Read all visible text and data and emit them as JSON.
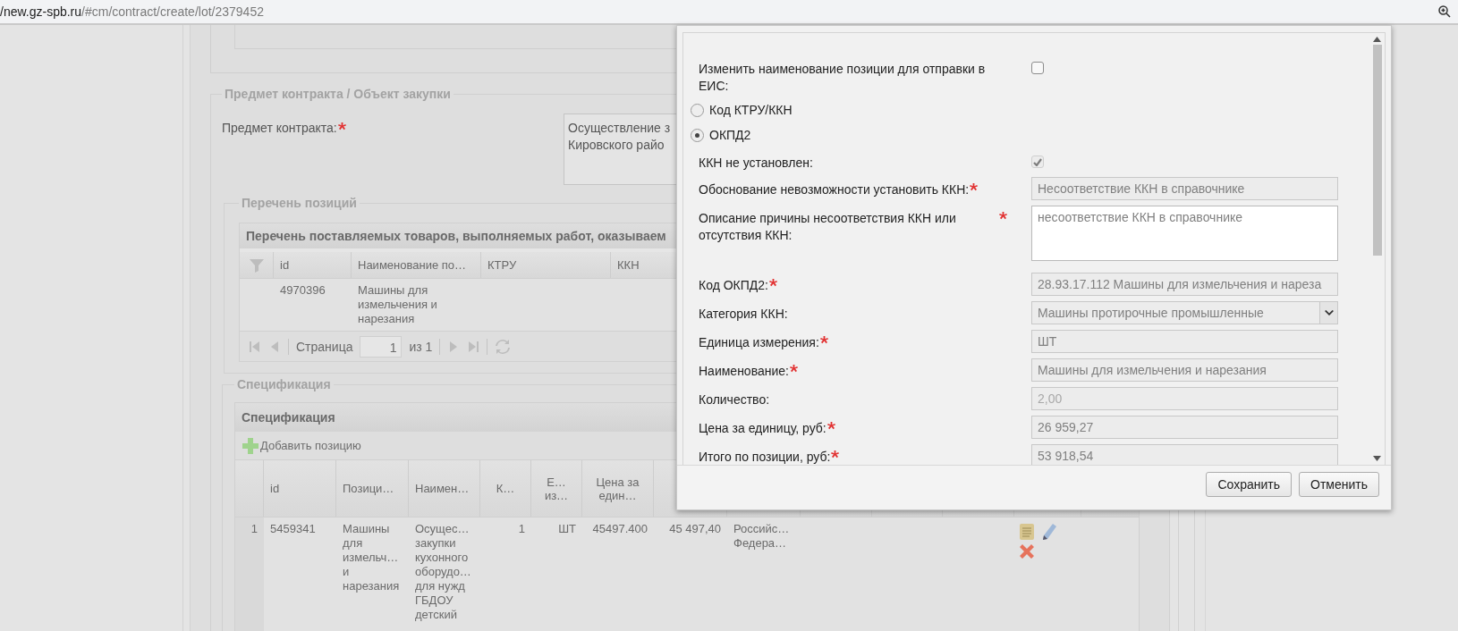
{
  "address_bar": {
    "host": "/new.gz-spb.ru",
    "path": "/#cm/contract/create/lot/2379452"
  },
  "contract_subject": {
    "legend": "Предмет контракта / Объект закупки",
    "label": "Предмет контракта:",
    "required": true,
    "value": "Осуществление з\nКировского райо"
  },
  "positions": {
    "legend": "Перечень позиций",
    "grid_title": "Перечень поставляемых товаров, выполняемых работ, оказываем",
    "columns": [
      "id",
      "Наименование по…",
      "КТРУ",
      "ККН"
    ],
    "rows": [
      {
        "cells": [
          "4970396",
          "Машины для\nизмельчения и\nнарезания"
        ]
      }
    ],
    "pager": {
      "page_label": "Страница",
      "page": "1",
      "total": "из 1"
    }
  },
  "specification": {
    "legend": "Спецификация",
    "grid_title": "Спецификация",
    "add_button": "Добавить позицию",
    "columns": [
      "id",
      "Позици…",
      "Наимен…",
      "К…",
      "Е…\nиз…",
      "Цена за\nедин…"
    ],
    "rows": [
      {
        "number": "1",
        "cells": [
          "5459341",
          "Машины\nдля\nизмельч…\nи\nнарезания",
          "Осущес…\nзакупки\nкухонного\nоборудо…\nдля нужд\nГБДОУ\nдетский",
          "1",
          "ШТ",
          "45497.400",
          "45 497,40",
          "Российс…\nФедера…"
        ]
      }
    ]
  },
  "dialog": {
    "rows": [
      {
        "kind": "checkbox",
        "label": "Изменить наименование позиции для отправки в ЕИС:",
        "checked": false,
        "disabled": false
      },
      {
        "kind": "radio",
        "label": "Код КТРУ/ККН",
        "selected": false
      },
      {
        "kind": "radio",
        "label": "ОКПД2",
        "selected": true
      },
      {
        "kind": "checkbox",
        "label": "ККН не установлен:",
        "checked": true,
        "disabled": true
      },
      {
        "kind": "text",
        "label": "Обоснование невозможности установить ККН:",
        "required": true,
        "value": "Несоответствие ККН в справочнике",
        "disabled": false
      },
      {
        "kind": "textarea",
        "label": "Описание причины несоответствия ККН или отсутствия ККН:",
        "required": true,
        "value": "несоответствие ККН в справочнике"
      },
      {
        "kind": "text",
        "label": "Код ОКПД2:",
        "required": true,
        "value": "28.93.17.112 Машины для измельчения и нареза",
        "disabled": false
      },
      {
        "kind": "select",
        "label": "Категория ККН:",
        "required": false,
        "value": "Машины протирочные промышленные"
      },
      {
        "kind": "text",
        "label": "Единица измерения:",
        "required": true,
        "value": "ШТ",
        "disabled": false
      },
      {
        "kind": "text",
        "label": "Наименование:",
        "required": true,
        "value": "Машины для измельчения и нарезания",
        "disabled": false
      },
      {
        "kind": "text",
        "label": "Количество:",
        "required": false,
        "value": "2,00",
        "disabled": true
      },
      {
        "kind": "text",
        "label": "Цена за единицу, руб:",
        "required": true,
        "value": "26 959,27",
        "disabled": false
      },
      {
        "kind": "text",
        "label": "Итого по позиции, руб:",
        "required": true,
        "value": "53 918,54",
        "disabled": false
      }
    ],
    "buttons": [
      "Сохранить",
      "Отменить"
    ]
  }
}
